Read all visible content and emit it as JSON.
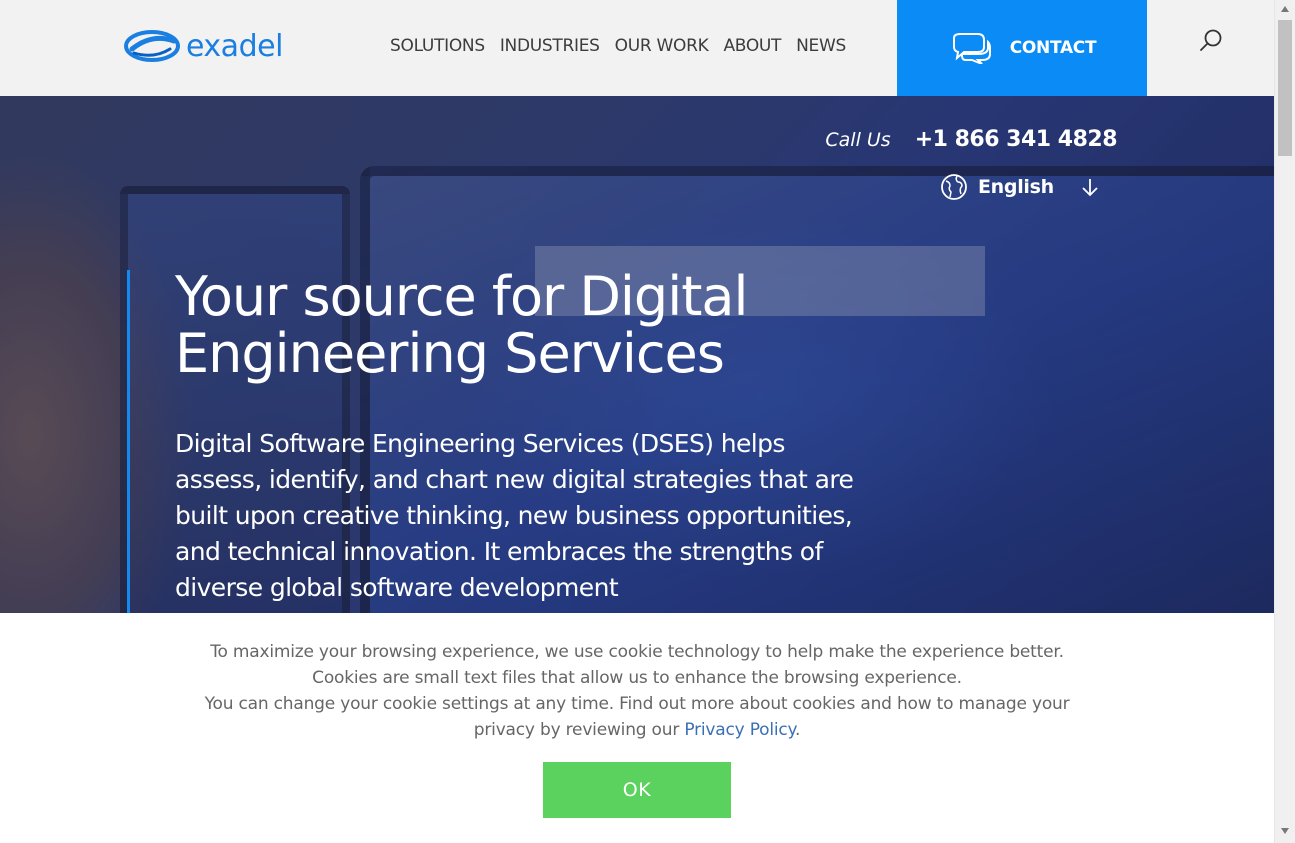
{
  "header": {
    "logo_text": "exadel",
    "nav": [
      "SOLUTIONS",
      "INDUSTRIES",
      "OUR WORK",
      "ABOUT",
      "NEWS"
    ],
    "contact_label": "CONTACT"
  },
  "hero": {
    "call_label": "Call Us",
    "phone": "+1 866 341 4828",
    "language": "English",
    "title_line1": "Your source for Digital",
    "title_line2": "Engineering Services",
    "description": "Digital Software Engineering Services (DSES) helps assess, identify, and chart new digital strategies that are built upon creative thinking, new business opportunities, and technical innovation. It embraces the strengths of diverse global software development"
  },
  "cookie": {
    "line1": "To maximize your browsing experience, we use cookie technology to help make the experience better. Cookies are small text files that allow us to enhance the browsing experience.",
    "line2": "You can change your cookie settings at any time. Find out more about cookies and how to manage your privacy by reviewing our",
    "link": "Privacy Policy",
    "after_link": ".",
    "ok_label": "OK"
  },
  "colors": {
    "brand_blue": "#0a8bf5",
    "ok_green": "#5bd15e",
    "link_blue": "#3a6fb5"
  }
}
